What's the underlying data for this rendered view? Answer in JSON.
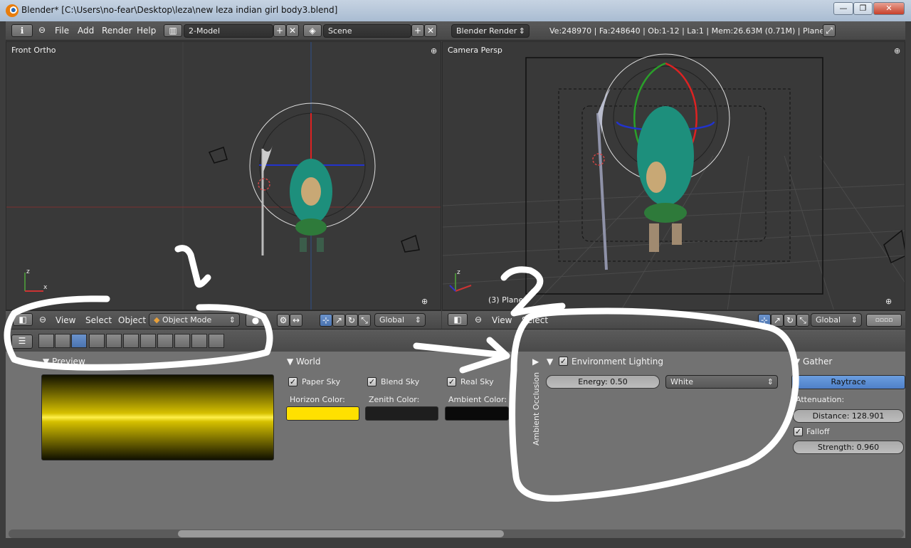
{
  "window": {
    "title": "Blender* [C:\\Users\\no-fear\\Desktop\\leza\\new leza indian girl body3.blend]"
  },
  "info_header": {
    "menu": [
      "File",
      "Add",
      "Render",
      "Help"
    ],
    "screen": "2-Model",
    "scene": "Scene",
    "engine": "Blender Render",
    "stats": "Ve:248970 | Fa:248640 | Ob:1-12 | La:1 | Mem:26.63M (0.71M) | Plane"
  },
  "viewport_left": {
    "label": "Front Ortho",
    "menu": [
      "View",
      "Select",
      "Object"
    ],
    "mode": "Object Mode",
    "orientation": "Global"
  },
  "viewport_right": {
    "label": "Camera Persp",
    "object_label": "(3) Plane",
    "menu": [
      "View",
      "Select"
    ],
    "orientation": "Global"
  },
  "properties": {
    "preview_title": "Preview",
    "world": {
      "title": "World",
      "paper_sky": "Paper Sky",
      "blend_sky": "Blend Sky",
      "real_sky": "Real Sky",
      "horizon_label": "Horizon Color:",
      "zenith_label": "Zenith Color:",
      "ambient_label": "Ambient Color:",
      "horizon_color": "#ffe000",
      "zenith_color": "#1e1e1e",
      "ambient_color": "#0a0a0a"
    },
    "env": {
      "title": "Environment Lighting",
      "energy": "Energy: 0.50",
      "color_mode": "White",
      "ao_label": "Ambient Occlusion"
    },
    "gather": {
      "title": "Gather",
      "method": "Raytrace",
      "attenuation": "Attenuation:",
      "distance": "Distance: 128.901",
      "falloff": "Falloff",
      "strength": "Strength: 0.960"
    }
  },
  "annotations": {
    "one": "1",
    "two": "2"
  },
  "colors": {
    "accent": "#5680c2",
    "bg": "#393939",
    "panel": "#727272"
  }
}
